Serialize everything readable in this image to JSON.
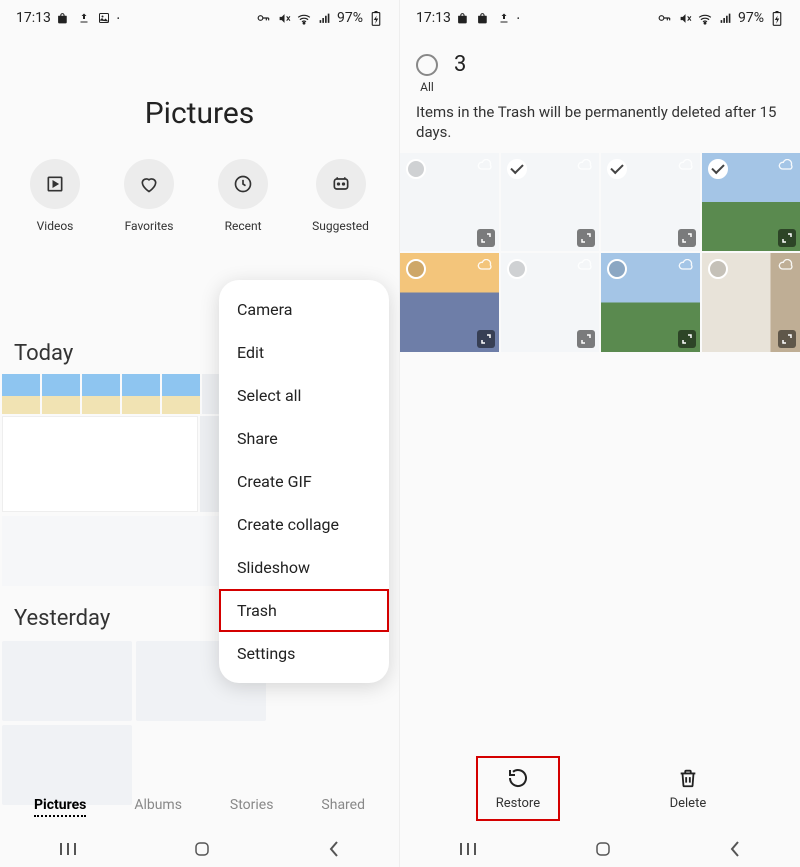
{
  "status": {
    "time": "17:13",
    "battery": "97%"
  },
  "left": {
    "title": "Pictures",
    "categories": [
      {
        "id": "videos",
        "label": "Videos"
      },
      {
        "id": "favorites",
        "label": "Favorites"
      },
      {
        "id": "recent",
        "label": "Recent"
      },
      {
        "id": "suggested",
        "label": "Suggested"
      }
    ],
    "sections": {
      "today": "Today",
      "yesterday": "Yesterday"
    },
    "menu": [
      "Camera",
      "Edit",
      "Select all",
      "Share",
      "Create GIF",
      "Create collage",
      "Slideshow",
      "Trash",
      "Settings"
    ],
    "menu_highlight_index": 7,
    "tabs": [
      {
        "label": "Pictures",
        "active": true
      },
      {
        "label": "Albums",
        "active": false
      },
      {
        "label": "Stories",
        "active": false
      },
      {
        "label": "Shared",
        "active": false
      }
    ]
  },
  "right": {
    "select_all_label": "All",
    "selected_count": "3",
    "note": "Items in the Trash will be permanently deleted after 15 days.",
    "thumbs": [
      {
        "selected": false,
        "bg": "bg-settings"
      },
      {
        "selected": true,
        "bg": "bg-settings"
      },
      {
        "selected": true,
        "bg": "bg-settings"
      },
      {
        "selected": true,
        "bg": "bg-landscape"
      },
      {
        "selected": false,
        "bg": "bg-sunset"
      },
      {
        "selected": false,
        "bg": "bg-settings"
      },
      {
        "selected": false,
        "bg": "bg-landscape"
      },
      {
        "selected": false,
        "bg": "bg-wall"
      }
    ],
    "actions": {
      "restore": "Restore",
      "delete": "Delete"
    },
    "highlight_action": "restore"
  }
}
